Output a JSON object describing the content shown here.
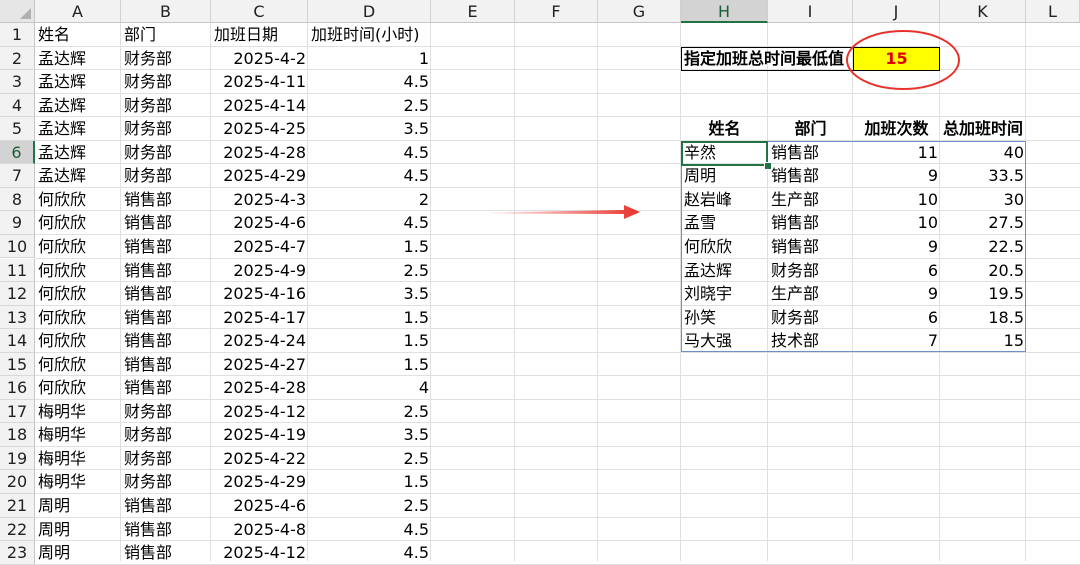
{
  "columns": [
    "A",
    "B",
    "C",
    "D",
    "E",
    "F",
    "G",
    "H",
    "I",
    "J",
    "K",
    "L"
  ],
  "rows": [
    {
      "n": "1",
      "a": "姓名",
      "b": "部门",
      "c": "加班日期",
      "d": "加班时间(小时)"
    },
    {
      "n": "2",
      "a": "孟达辉",
      "b": "财务部",
      "c": "2025-4-2",
      "d": "1"
    },
    {
      "n": "3",
      "a": "孟达辉",
      "b": "财务部",
      "c": "2025-4-11",
      "d": "4.5"
    },
    {
      "n": "4",
      "a": "孟达辉",
      "b": "财务部",
      "c": "2025-4-14",
      "d": "2.5"
    },
    {
      "n": "5",
      "a": "孟达辉",
      "b": "财务部",
      "c": "2025-4-25",
      "d": "3.5"
    },
    {
      "n": "6",
      "a": "孟达辉",
      "b": "财务部",
      "c": "2025-4-28",
      "d": "4.5"
    },
    {
      "n": "7",
      "a": "孟达辉",
      "b": "财务部",
      "c": "2025-4-29",
      "d": "4.5"
    },
    {
      "n": "8",
      "a": "何欣欣",
      "b": "销售部",
      "c": "2025-4-3",
      "d": "2"
    },
    {
      "n": "9",
      "a": "何欣欣",
      "b": "销售部",
      "c": "2025-4-6",
      "d": "4.5"
    },
    {
      "n": "10",
      "a": "何欣欣",
      "b": "销售部",
      "c": "2025-4-7",
      "d": "1.5"
    },
    {
      "n": "11",
      "a": "何欣欣",
      "b": "销售部",
      "c": "2025-4-9",
      "d": "2.5"
    },
    {
      "n": "12",
      "a": "何欣欣",
      "b": "销售部",
      "c": "2025-4-16",
      "d": "3.5"
    },
    {
      "n": "13",
      "a": "何欣欣",
      "b": "销售部",
      "c": "2025-4-17",
      "d": "1.5"
    },
    {
      "n": "14",
      "a": "何欣欣",
      "b": "销售部",
      "c": "2025-4-24",
      "d": "1.5"
    },
    {
      "n": "15",
      "a": "何欣欣",
      "b": "销售部",
      "c": "2025-4-27",
      "d": "1.5"
    },
    {
      "n": "16",
      "a": "何欣欣",
      "b": "销售部",
      "c": "2025-4-28",
      "d": "4"
    },
    {
      "n": "17",
      "a": "梅明华",
      "b": "财务部",
      "c": "2025-4-12",
      "d": "2.5"
    },
    {
      "n": "18",
      "a": "梅明华",
      "b": "财务部",
      "c": "2025-4-19",
      "d": "3.5"
    },
    {
      "n": "19",
      "a": "梅明华",
      "b": "财务部",
      "c": "2025-4-22",
      "d": "2.5"
    },
    {
      "n": "20",
      "a": "梅明华",
      "b": "财务部",
      "c": "2025-4-29",
      "d": "1.5"
    },
    {
      "n": "21",
      "a": "周明",
      "b": "销售部",
      "c": "2025-4-6",
      "d": "2.5"
    },
    {
      "n": "22",
      "a": "周明",
      "b": "销售部",
      "c": "2025-4-8",
      "d": "4.5"
    },
    {
      "n": "23",
      "a": "周明",
      "b": "销售部",
      "c": "2025-4-12",
      "d": "4.5"
    }
  ],
  "criteria": {
    "label": "指定加班总时间最低值",
    "value": "15"
  },
  "summary": {
    "headers": [
      "姓名",
      "部门",
      "加班次数",
      "总加班时间"
    ],
    "rows": [
      [
        "辛然",
        "销售部",
        "11",
        "40"
      ],
      [
        "周明",
        "销售部",
        "9",
        "33.5"
      ],
      [
        "赵岩峰",
        "生产部",
        "10",
        "30"
      ],
      [
        "孟雪",
        "销售部",
        "10",
        "27.5"
      ],
      [
        "何欣欣",
        "销售部",
        "9",
        "22.5"
      ],
      [
        "孟达辉",
        "财务部",
        "6",
        "20.5"
      ],
      [
        "刘晓宇",
        "生产部",
        "9",
        "19.5"
      ],
      [
        "孙笑",
        "财务部",
        "6",
        "18.5"
      ],
      [
        "马大强",
        "技术部",
        "7",
        "15"
      ]
    ]
  },
  "selection": {
    "column": "H",
    "row": "6"
  },
  "colors": {
    "accent": "#217346",
    "annotation": "#e8322a",
    "highlight": "#ffff00",
    "value_text": "#e00000",
    "table_border": "#6f8fc7"
  }
}
